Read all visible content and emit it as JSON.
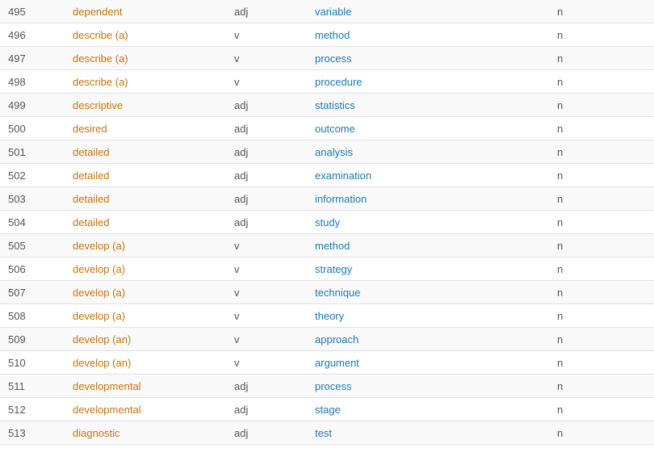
{
  "rows": [
    {
      "num": "495",
      "word": "dependent",
      "pos": "adj",
      "collocate": "variable",
      "extra": "n"
    },
    {
      "num": "496",
      "word": "describe (a)",
      "pos": "v",
      "collocate": "method",
      "extra": "n"
    },
    {
      "num": "497",
      "word": "describe (a)",
      "pos": "v",
      "collocate": "process",
      "extra": "n"
    },
    {
      "num": "498",
      "word": "describe (a)",
      "pos": "v",
      "collocate": "procedure",
      "extra": "n"
    },
    {
      "num": "499",
      "word": "descriptive",
      "pos": "adj",
      "collocate": "statistics",
      "extra": "n"
    },
    {
      "num": "500",
      "word": "desired",
      "pos": "adj",
      "collocate": "outcome",
      "extra": "n"
    },
    {
      "num": "501",
      "word": "detailed",
      "pos": "adj",
      "collocate": "analysis",
      "extra": "n"
    },
    {
      "num": "502",
      "word": "detailed",
      "pos": "adj",
      "collocate": "examination",
      "extra": "n"
    },
    {
      "num": "503",
      "word": "detailed",
      "pos": "adj",
      "collocate": "information",
      "extra": "n"
    },
    {
      "num": "504",
      "word": "detailed",
      "pos": "adj",
      "collocate": "study",
      "extra": "n"
    },
    {
      "num": "505",
      "word": "develop (a)",
      "pos": "v",
      "collocate": "method",
      "extra": "n"
    },
    {
      "num": "506",
      "word": "develop (a)",
      "pos": "v",
      "collocate": "strategy",
      "extra": "n"
    },
    {
      "num": "507",
      "word": "develop (a)",
      "pos": "v",
      "collocate": "technique",
      "extra": "n"
    },
    {
      "num": "508",
      "word": "develop (a)",
      "pos": "v",
      "collocate": "theory",
      "extra": "n"
    },
    {
      "num": "509",
      "word": "develop (an)",
      "pos": "v",
      "collocate": "approach",
      "extra": "n"
    },
    {
      "num": "510",
      "word": "develop (an)",
      "pos": "v",
      "collocate": "argument",
      "extra": "n"
    },
    {
      "num": "511",
      "word": "developmental",
      "pos": "adj",
      "collocate": "process",
      "extra": "n"
    },
    {
      "num": "512",
      "word": "developmental",
      "pos": "adj",
      "collocate": "stage",
      "extra": "n"
    },
    {
      "num": "513",
      "word": "diagnostic",
      "pos": "adj",
      "collocate": "test",
      "extra": "n"
    }
  ]
}
